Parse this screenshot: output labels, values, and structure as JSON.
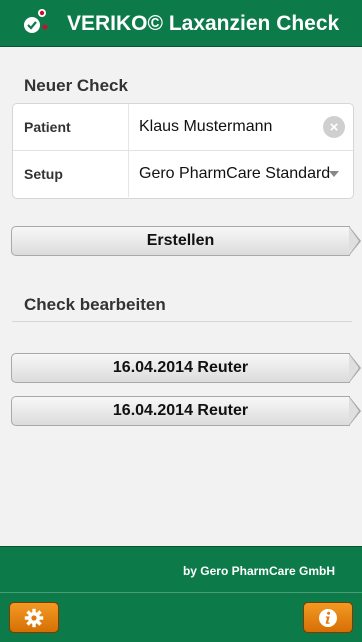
{
  "header": {
    "title": "VERIKO© Laxanzien Check",
    "logo_icon": "veriko-logo-icon"
  },
  "new_check": {
    "section_label": "Neuer Check",
    "patient_label": "Patient",
    "patient_value": "Klaus Mustermann",
    "setup_label": "Setup",
    "setup_value": "Gero PharmCare Standard",
    "create_button": "Erstellen"
  },
  "edit_check": {
    "section_label": "Check bearbeiten",
    "items": [
      {
        "label": "16.04.2014 Reuter"
      },
      {
        "label": "16.04.2014 Reuter"
      }
    ]
  },
  "footer": {
    "credit": "by Gero PharmCare GmbH"
  },
  "toolbar": {
    "settings_icon": "gear-icon",
    "info_icon": "info-icon"
  },
  "colors": {
    "brand_green": "#0d7a4a",
    "accent_orange": "#e8820f"
  }
}
